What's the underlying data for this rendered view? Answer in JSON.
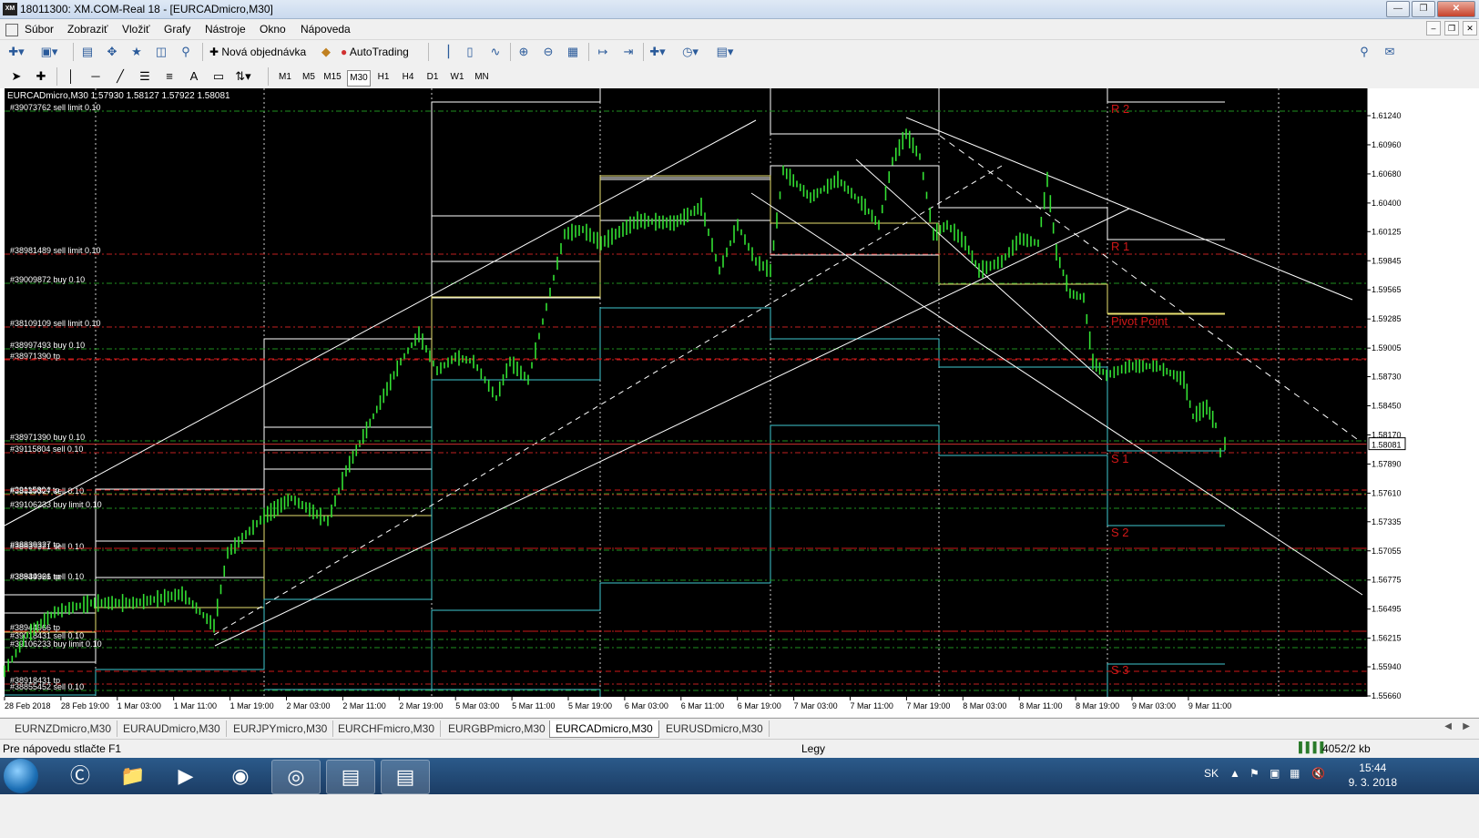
{
  "window": {
    "title": "18011300: XM.COM-Real 18 - [EURCADmicro,M30]",
    "app_icon": "XM"
  },
  "menu": [
    "Súbor",
    "Zobraziť",
    "Vložiť",
    "Grafy",
    "Nástroje",
    "Okno",
    "Nápoveda"
  ],
  "toolbar": {
    "new_order": "Nová objednávka",
    "autotrading": "AutoTrading"
  },
  "timeframes": [
    "M1",
    "M5",
    "M15",
    "M30",
    "H1",
    "H4",
    "D1",
    "W1",
    "MN"
  ],
  "active_timeframe": "M30",
  "chart": {
    "header": "EURCADmicro,M30  1.57930 1.58127 1.57922 1.58081",
    "current_price": "1.58081",
    "price_ticks": [
      "1.61240",
      "1.60960",
      "1.60680",
      "1.60400",
      "1.60125",
      "1.59845",
      "1.59565",
      "1.59285",
      "1.59005",
      "1.58730",
      "1.58450",
      "1.58170",
      "1.57890",
      "1.57610",
      "1.57335",
      "1.57055",
      "1.56775",
      "1.56495",
      "1.56215",
      "1.55940",
      "1.55660"
    ],
    "time_ticks": [
      "28 Feb 2018",
      "28 Feb 19:00",
      "1 Mar 03:00",
      "1 Mar 11:00",
      "1 Mar 19:00",
      "2 Mar 03:00",
      "2 Mar 11:00",
      "2 Mar 19:00",
      "5 Mar 03:00",
      "5 Mar 11:00",
      "5 Mar 19:00",
      "6 Mar 03:00",
      "6 Mar 11:00",
      "6 Mar 19:00",
      "7 Mar 03:00",
      "7 Mar 11:00",
      "7 Mar 19:00",
      "8 Mar 03:00",
      "8 Mar 11:00",
      "8 Mar 19:00",
      "9 Mar 03:00",
      "9 Mar 11:00"
    ],
    "pivot_labels": [
      "R 2",
      "R 1",
      "Pivot Point",
      "S 1",
      "S 2",
      "S 3"
    ],
    "order_labels": [
      "#39073762 sell limit 0.10",
      "#38981489 sell limit 0.10",
      "#39009872 buy 0.10",
      "#38109109 sell limit 0.10",
      "#38997493 buy 0.10",
      "#38971390 tp",
      "#38971390 buy 0.10",
      "#39115804 sell 0.10",
      "#39115804 tp",
      "#38839327 sell 0.10",
      "#39106233 buy limit 0.10",
      "#38839327 tp",
      "#38839321 sell 0.10",
      "#38839321 tp",
      "#38944966 sell 0.10",
      "#38944966 tp",
      "#39018431 sell 0.10",
      "#39106233 buy limit 0.10",
      "#38918431 tp",
      "#38855452 sell 0.10"
    ],
    "colors": {
      "bg": "#000000",
      "candle": "#33e033",
      "trend": "#ffffff",
      "upper_band": "#ffffff",
      "mid_band": "#e8e070",
      "lower_band": "#40c8d0",
      "pivot": "#d01818",
      "order_green": "#209020",
      "order_red": "#c02020",
      "price_line": "#d03030"
    }
  },
  "tabs": [
    "EURNZDmicro,M30",
    "EURAUDmicro,M30",
    "EURJPYmicro,M30",
    "EURCHFmicro,M30",
    "EURGBPmicro,M30",
    "EURCADmicro,M30",
    "EURUSDmicro,M30"
  ],
  "active_tab": "EURCADmicro,M30",
  "status": {
    "help": "Pre nápovedu stlačte F1",
    "profile": "Legy",
    "traffic": "4052/2 kb"
  },
  "taskbar": {
    "lang": "SK",
    "time": "15:44",
    "date": "9. 3. 2018"
  }
}
